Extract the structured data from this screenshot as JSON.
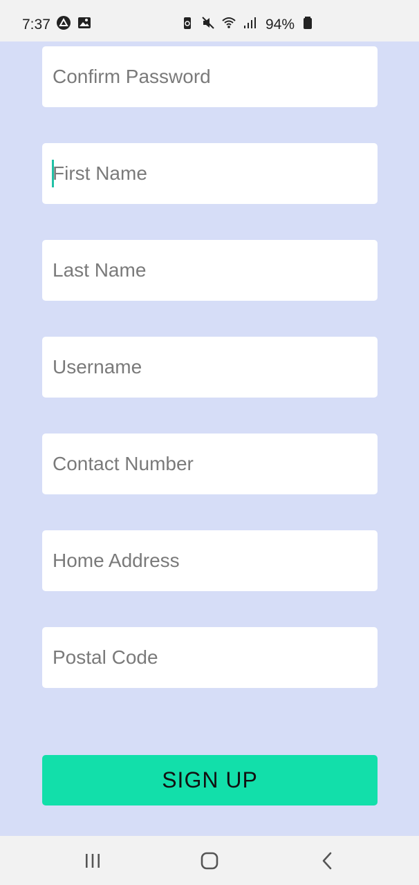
{
  "status_bar": {
    "time": "7:37",
    "battery": "94%",
    "icons": [
      "android-auto-icon",
      "gallery-icon",
      "battery-saver-icon",
      "mute-icon",
      "wifi-icon",
      "signal-icon",
      "battery-icon"
    ]
  },
  "form": {
    "fields": [
      {
        "placeholder": "Confirm Password"
      },
      {
        "placeholder": "First Name"
      },
      {
        "placeholder": "Last Name"
      },
      {
        "placeholder": "Username"
      },
      {
        "placeholder": "Contact Number"
      },
      {
        "placeholder": "Home Address"
      },
      {
        "placeholder": "Postal Code"
      }
    ],
    "submit_label": "SIGN UP"
  },
  "colors": {
    "background": "#d6ddf7",
    "accent": "#12dfaa"
  },
  "nav_bar": {
    "icons": [
      "recent-apps-icon",
      "home-icon",
      "back-icon"
    ]
  }
}
